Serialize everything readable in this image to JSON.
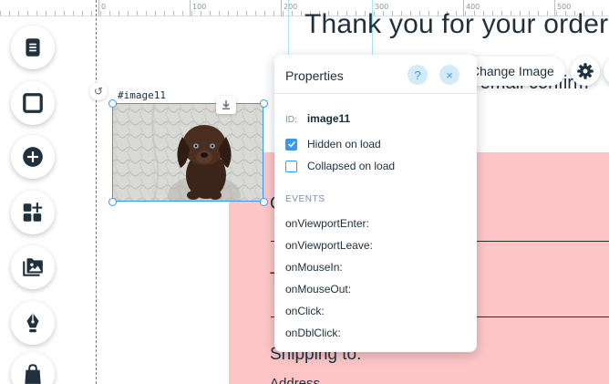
{
  "ruler": {
    "labels": [
      "0",
      "100",
      "200",
      "300",
      "400",
      "500",
      "600"
    ]
  },
  "page": {
    "title": "Thank you for your order",
    "email_text": "n email confirm",
    "frag_c": "C",
    "frag_t": "T",
    "shipping": "Shipping to:",
    "address": "Address"
  },
  "image": {
    "label": "#image11"
  },
  "panel": {
    "title": "Properties",
    "help": "?",
    "close": "×",
    "id_label": "ID:",
    "id_value": "image11",
    "hidden_on_load": {
      "label": "Hidden on load",
      "checked": true
    },
    "collapsed_on_load": {
      "label": "Collapsed on load",
      "checked": false
    },
    "events_title": "EVENTS",
    "events": [
      "onViewportEnter:",
      "onViewportLeave:",
      "onMouseIn:",
      "onMouseOut:",
      "onClick:",
      "onDblClick:"
    ]
  },
  "actions": {
    "change_image": "Change Image"
  },
  "toolbar": {
    "items": [
      "pages-icon",
      "box-icon",
      "add-icon",
      "add-apps-icon",
      "media-icon",
      "pen-icon",
      "store-icon"
    ]
  },
  "colors": {
    "accent": "#3899ec",
    "pink": "#fdc5c6",
    "text": "#20303c"
  }
}
